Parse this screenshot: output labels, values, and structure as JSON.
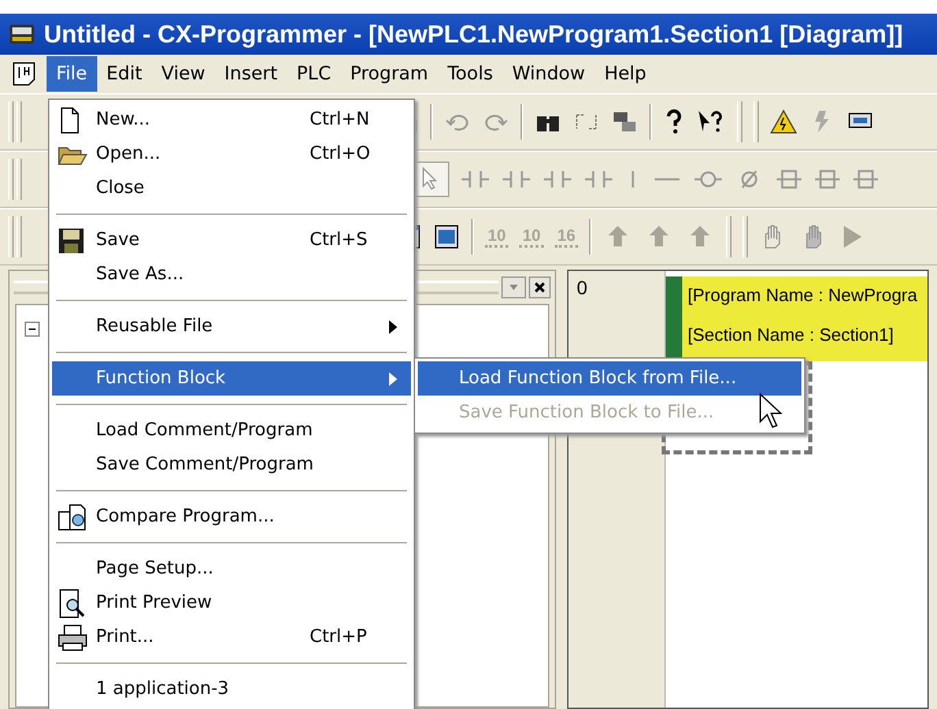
{
  "window": {
    "title": "Untitled - CX-Programmer - [NewPLC1.NewProgram1.Section1 [Diagram]]"
  },
  "menu_bar": [
    {
      "label": "File",
      "selected": true
    },
    {
      "label": "Edit",
      "selected": false
    },
    {
      "label": "View",
      "selected": false
    },
    {
      "label": "Insert",
      "selected": false
    },
    {
      "label": "PLC",
      "selected": false
    },
    {
      "label": "Program",
      "selected": false
    },
    {
      "label": "Tools",
      "selected": false
    },
    {
      "label": "Window",
      "selected": false
    },
    {
      "label": "Help",
      "selected": false
    }
  ],
  "toolbar_labels": [
    "10",
    "10",
    "16"
  ],
  "file_menu": [
    {
      "kind": "item",
      "label": "New...",
      "shortcut": "Ctrl+N"
    },
    {
      "kind": "item",
      "label": "Open...",
      "shortcut": "Ctrl+O"
    },
    {
      "kind": "item",
      "label": "Close"
    },
    {
      "kind": "separator"
    },
    {
      "kind": "item",
      "label": "Save",
      "shortcut": "Ctrl+S"
    },
    {
      "kind": "item",
      "label": "Save As..."
    },
    {
      "kind": "separator"
    },
    {
      "kind": "submenu",
      "label": "Reusable File",
      "selected": false
    },
    {
      "kind": "separator"
    },
    {
      "kind": "submenu",
      "label": "Function Block",
      "selected": true,
      "children": [
        {
          "label": "Load Function Block from File...",
          "selected": true,
          "disabled": false
        },
        {
          "label": "Save Function Block to File...",
          "selected": false,
          "disabled": true
        }
      ]
    },
    {
      "kind": "separator"
    },
    {
      "kind": "item",
      "label": "Load Comment/Program"
    },
    {
      "kind": "item",
      "label": "Save Comment/Program"
    },
    {
      "kind": "separator"
    },
    {
      "kind": "item",
      "label": "Compare Program..."
    },
    {
      "kind": "separator"
    },
    {
      "kind": "item",
      "label": "Page Setup..."
    },
    {
      "kind": "item",
      "label": "Print Preview"
    },
    {
      "kind": "item",
      "label": "Print...",
      "shortcut": "Ctrl+P"
    },
    {
      "kind": "separator"
    },
    {
      "kind": "item",
      "label": "1 application-3"
    }
  ],
  "diagram": {
    "rung_number": "0",
    "program_name": "[Program Name : NewProgra",
    "section_name": "[Section Name : Section1]"
  }
}
